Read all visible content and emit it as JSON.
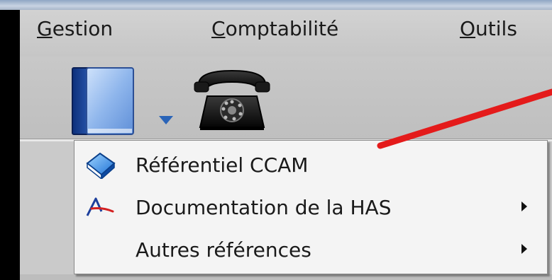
{
  "menubar": {
    "items": [
      {
        "label": "Gestion"
      },
      {
        "label": "Comptabilité"
      },
      {
        "label": "Outils"
      }
    ]
  },
  "toolbar": {
    "book_icon": "book-icon",
    "dropdown_icon": "chevron-down-icon",
    "phone_icon": "telephone-icon"
  },
  "dropdown": {
    "items": [
      {
        "label": "Référentiel CCAM",
        "icon": "book-icon",
        "has_submenu": false
      },
      {
        "label": "Documentation de la HAS",
        "icon": "has-logo-icon",
        "has_submenu": true
      },
      {
        "label": "Autres références",
        "icon": "",
        "has_submenu": true
      }
    ]
  },
  "colors": {
    "annotation_line": "#e41b1b",
    "menu_bg": "#c9c9c9",
    "dropdown_bg": "#f4f4f4",
    "dropdown_arrow_blue": "#2a64b8"
  }
}
